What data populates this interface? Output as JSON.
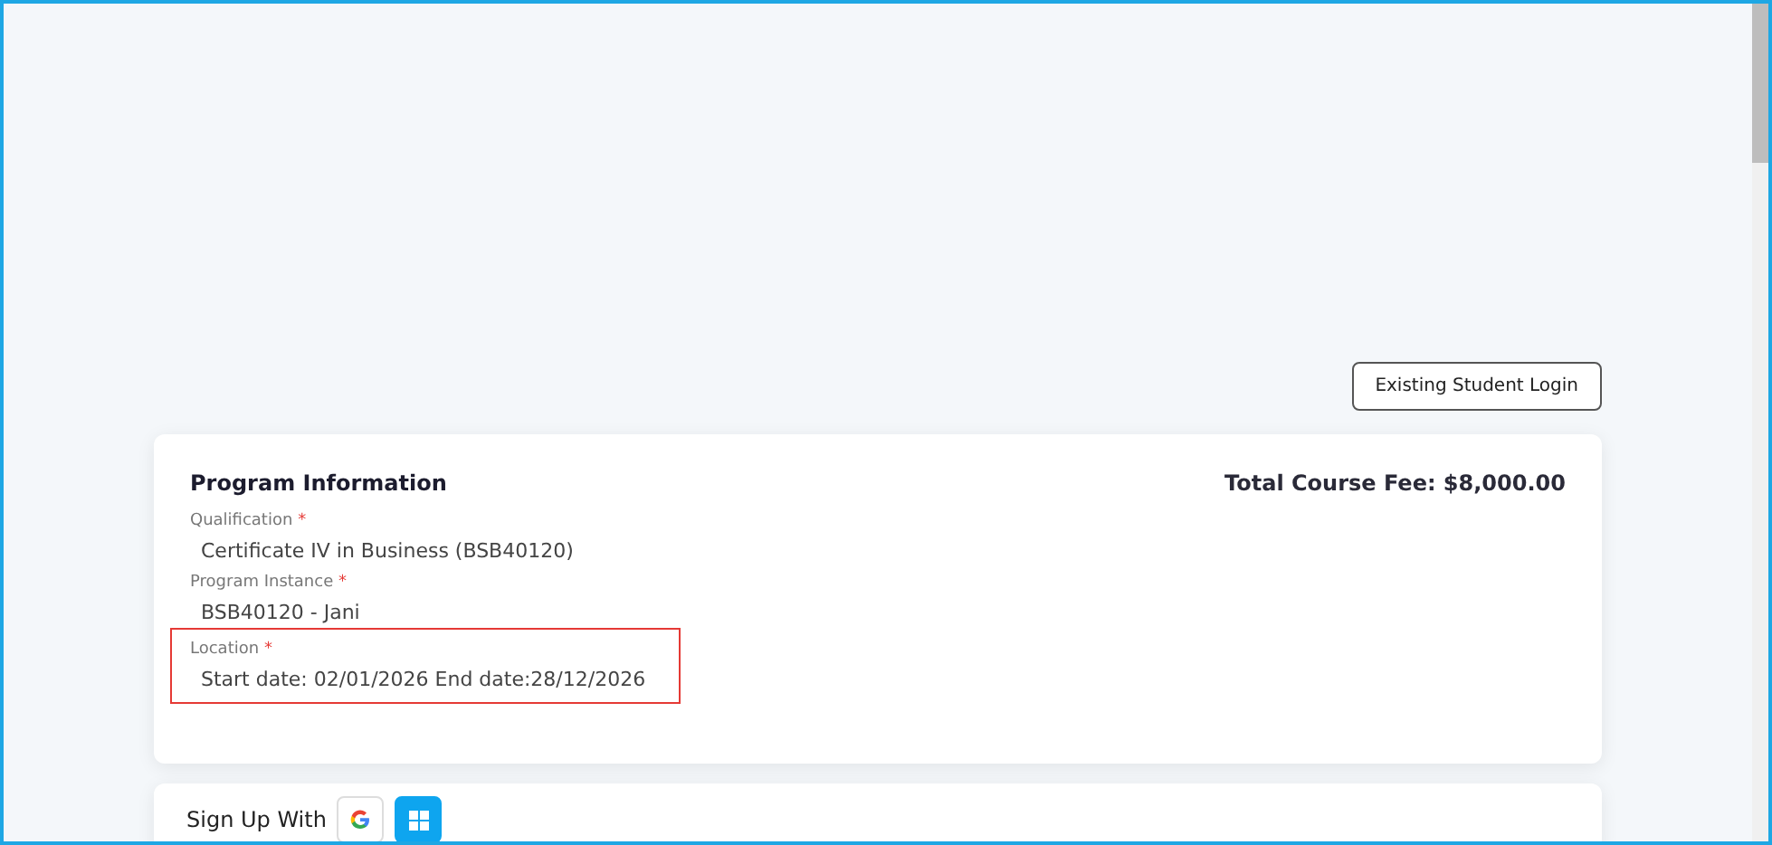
{
  "header": {
    "login_button": "Existing Student Login"
  },
  "program_card": {
    "title": "Program Information",
    "total_fee": "Total Course Fee: $8,000.00",
    "fields": [
      {
        "label": "Qualification",
        "required_mark": "*",
        "value": "Certificate IV in Business (BSB40120)",
        "highlighted": false
      },
      {
        "label": "Program Instance",
        "required_mark": "*",
        "value": "BSB40120 - Jani",
        "highlighted": false
      },
      {
        "label": "Location",
        "required_mark": "*",
        "value": "Start date: 02/01/2026 End date:28/12/2026",
        "highlighted": true
      }
    ]
  },
  "signup_card": {
    "label": "Sign Up With",
    "providers": [
      {
        "kind": "google",
        "selected": false
      },
      {
        "kind": "microsoft",
        "selected": true
      }
    ]
  }
}
